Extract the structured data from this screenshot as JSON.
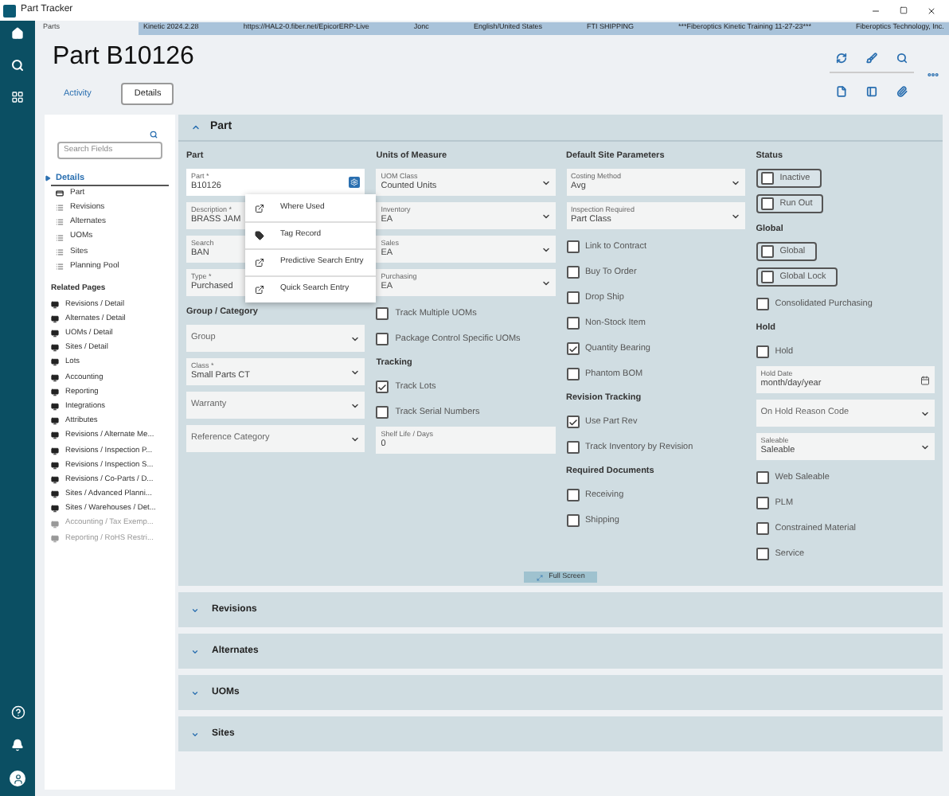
{
  "window": {
    "title": "Part Tracker"
  },
  "breadcrumb": "Parts",
  "info_bar": [
    "Kinetic 2024.2.28",
    "https://HAL2-0.fiber.net/EpicorERP-Live",
    "Jonc",
    "English/United States",
    "FTI SHIPPING",
    "***Fiberoptics Kinetic Training 11-27-23***",
    "Fiberoptics Technology, Inc."
  ],
  "page": {
    "title": "Part B10126"
  },
  "tabs": [
    {
      "label": "Activity",
      "selected": false
    },
    {
      "label": "Details",
      "selected": true
    }
  ],
  "sidebar": {
    "search": {
      "placeholder": "Search Fields"
    },
    "tree": [
      {
        "label": "Details",
        "expanded": true,
        "selected": true,
        "children": [
          {
            "label": "Part",
            "kind": "card"
          },
          {
            "label": "Revisions",
            "kind": "list"
          },
          {
            "label": "Alternates",
            "kind": "list"
          },
          {
            "label": "UOMs",
            "kind": "list"
          },
          {
            "label": "Sites",
            "kind": "list"
          },
          {
            "label": "Planning Pool",
            "kind": "list"
          }
        ]
      }
    ],
    "related_title": "Related Pages",
    "related": [
      {
        "label": "Revisions / Detail",
        "disabled": false
      },
      {
        "label": "Alternates / Detail",
        "disabled": false
      },
      {
        "label": "UOMs / Detail",
        "disabled": false
      },
      {
        "label": "Sites / Detail",
        "disabled": false
      },
      {
        "label": "Lots",
        "disabled": false
      },
      {
        "label": "Accounting",
        "disabled": false
      },
      {
        "label": "Reporting",
        "disabled": false
      },
      {
        "label": "Integrations",
        "disabled": false
      },
      {
        "label": "Attributes",
        "disabled": false
      },
      {
        "label": "Revisions / Alternate Me...",
        "disabled": false
      },
      {
        "label": "Revisions / Inspection P...",
        "disabled": false
      },
      {
        "label": "Revisions / Inspection S...",
        "disabled": false
      },
      {
        "label": "Revisions / Co-Parts / D...",
        "disabled": false
      },
      {
        "label": "Sites / Advanced Planni...",
        "disabled": false
      },
      {
        "label": "Sites / Warehouses / Det...",
        "disabled": false
      },
      {
        "label": "Accounting / Tax Exemp...",
        "disabled": true
      },
      {
        "label": "Reporting / RoHS Restri...",
        "disabled": true
      }
    ]
  },
  "part_section": {
    "title": "Part",
    "expanded": true,
    "full_screen": "Full Screen",
    "columns": [
      {
        "groups": [
          {
            "title": "Part",
            "items": [
              {
                "kind": "text",
                "label": "Part *",
                "value": "B10126",
                "menu": true
              },
              {
                "kind": "text",
                "label": "Description *",
                "value": "BRASS JAM"
              },
              {
                "kind": "text",
                "label": "Search",
                "value": "BAN"
              },
              {
                "kind": "text",
                "label": "Type *",
                "value": "Purchased"
              }
            ]
          },
          {
            "title": "Group / Category",
            "items": [
              {
                "kind": "dropdown",
                "placeholder": "Group"
              },
              {
                "kind": "dropdown",
                "label": "Class *",
                "value": "Small Parts CT"
              },
              {
                "kind": "dropdown",
                "placeholder": "Warranty"
              },
              {
                "kind": "dropdown",
                "placeholder": "Reference Category"
              }
            ]
          }
        ]
      },
      {
        "groups": [
          {
            "title": "Units of Measure",
            "items": [
              {
                "kind": "dropdown",
                "label": "UOM Class",
                "value": "Counted Units"
              },
              {
                "kind": "dropdown",
                "label": "Inventory",
                "value": "EA"
              },
              {
                "kind": "dropdown",
                "label": "Sales",
                "value": "EA"
              },
              {
                "kind": "dropdown",
                "label": "Purchasing",
                "value": "EA"
              },
              {
                "kind": "checkbox",
                "label": "Track Multiple UOMs",
                "checked": false
              },
              {
                "kind": "checkbox",
                "label": "Package Control Specific UOMs",
                "checked": false
              }
            ]
          },
          {
            "title": "Tracking",
            "items": [
              {
                "kind": "checkbox",
                "label": "Track Lots",
                "checked": true
              },
              {
                "kind": "checkbox",
                "label": "Track Serial Numbers",
                "checked": false
              },
              {
                "kind": "text",
                "label": "Shelf Life / Days",
                "value": "0"
              }
            ]
          }
        ]
      },
      {
        "groups": [
          {
            "title": "Default Site Parameters",
            "items": [
              {
                "kind": "dropdown",
                "label": "Costing Method",
                "value": "Avg"
              },
              {
                "kind": "dropdown",
                "label": "Inspection Required",
                "value": "Part Class"
              },
              {
                "kind": "checkbox",
                "label": "Link to Contract",
                "checked": false
              },
              {
                "kind": "checkbox",
                "label": "Buy To Order",
                "checked": false
              },
              {
                "kind": "checkbox",
                "label": "Drop Ship",
                "checked": false
              },
              {
                "kind": "checkbox",
                "label": "Non-Stock Item",
                "checked": false
              },
              {
                "kind": "checkbox",
                "label": "Quantity Bearing",
                "checked": true
              },
              {
                "kind": "checkbox",
                "label": "Phantom BOM",
                "checked": false
              }
            ]
          },
          {
            "title": "Revision Tracking",
            "items": [
              {
                "kind": "checkbox",
                "label": "Use Part Rev",
                "checked": true
              },
              {
                "kind": "checkbox",
                "label": "Track Inventory by Revision",
                "checked": false
              }
            ]
          },
          {
            "title": "Required Documents",
            "items": [
              {
                "kind": "checkbox",
                "label": "Receiving",
                "checked": false
              },
              {
                "kind": "checkbox",
                "label": "Shipping",
                "checked": false
              }
            ]
          }
        ]
      },
      {
        "groups": [
          {
            "title": "Status",
            "items": [
              {
                "kind": "toggle",
                "label": "Inactive",
                "checked": false
              },
              {
                "kind": "toggle",
                "label": "Run Out",
                "checked": false
              }
            ]
          },
          {
            "title": "Global",
            "items": [
              {
                "kind": "toggle",
                "label": "Global",
                "checked": false
              },
              {
                "kind": "toggle",
                "label": "Global Lock",
                "checked": false
              },
              {
                "kind": "checkbox",
                "label": "Consolidated Purchasing",
                "checked": false
              }
            ]
          },
          {
            "title": "Hold",
            "items": [
              {
                "kind": "checkbox",
                "label": "Hold",
                "checked": false
              },
              {
                "kind": "date",
                "label": "Hold Date",
                "placeholder": "month/day/year"
              },
              {
                "kind": "dropdown",
                "placeholder": "On Hold Reason Code"
              },
              {
                "kind": "dropdown",
                "label": "Saleable",
                "value": "Saleable"
              },
              {
                "kind": "checkbox",
                "label": "Web Saleable",
                "checked": false
              },
              {
                "kind": "checkbox",
                "label": "PLM",
                "checked": false
              },
              {
                "kind": "checkbox",
                "label": "Constrained Material",
                "checked": false
              },
              {
                "kind": "checkbox",
                "label": "Service",
                "checked": false
              }
            ]
          }
        ]
      }
    ]
  },
  "context_menu": [
    {
      "label": "Where Used",
      "kind": "link"
    },
    {
      "label": "Tag Record",
      "kind": "tag"
    },
    {
      "label": "Predictive Search Entry",
      "kind": "link"
    },
    {
      "label": "Quick Search Entry",
      "kind": "link"
    }
  ],
  "sections": [
    {
      "title": "Revisions",
      "expanded": false
    },
    {
      "title": "Alternates",
      "expanded": false
    },
    {
      "title": "UOMs",
      "expanded": false
    },
    {
      "title": "Sites",
      "expanded": false
    }
  ]
}
